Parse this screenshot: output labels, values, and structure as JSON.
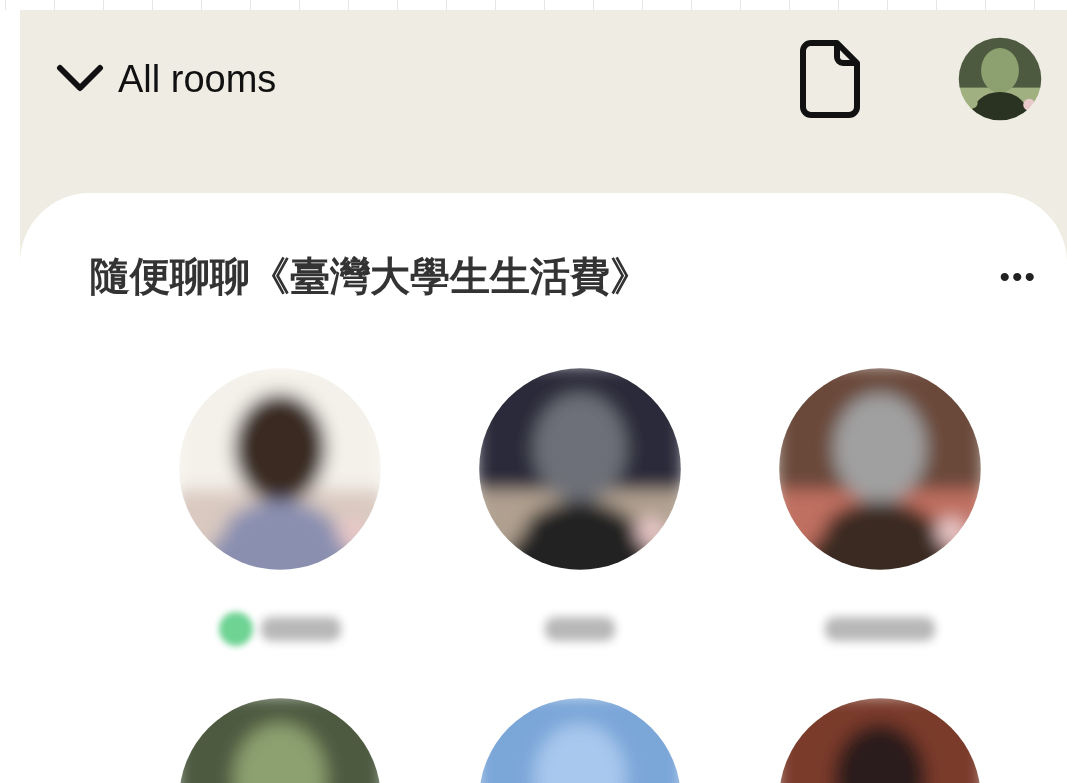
{
  "header": {
    "title": "All rooms"
  },
  "room": {
    "title": "隨便聊聊《臺灣大學生生活費》",
    "menu": "•••",
    "speakers": [
      {
        "kind": "picture",
        "badge": true
      },
      {
        "kind": "picture",
        "badge": false
      },
      {
        "kind": "picture",
        "badge": false
      },
      {
        "kind": "picture"
      },
      {
        "kind": "picture"
      },
      {
        "kind": "picture"
      }
    ]
  }
}
